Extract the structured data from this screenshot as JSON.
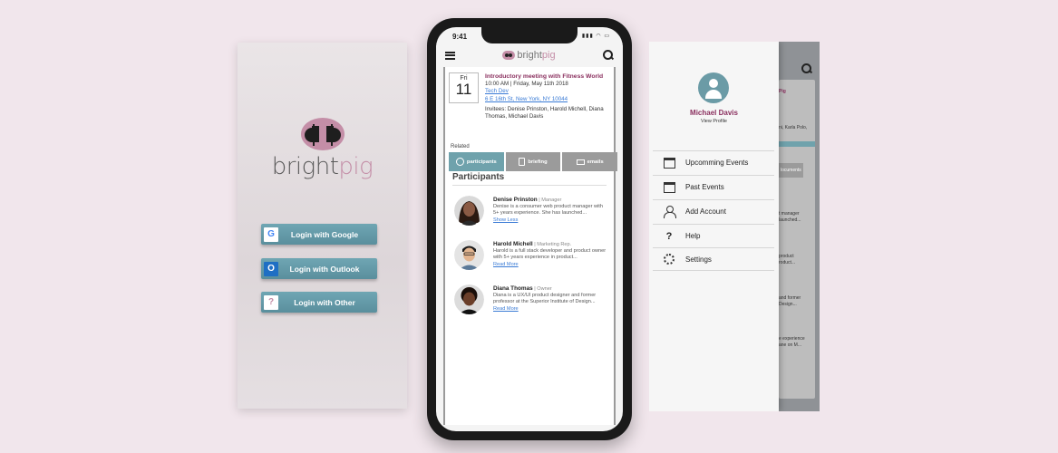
{
  "login": {
    "brand_prefix": "bright",
    "brand_suffix": "pig",
    "google_label": "Login with Google",
    "outlook_label": "Login with Outlook",
    "other_label": "Login with Other",
    "google_glyph": "G",
    "outlook_glyph": "O",
    "other_glyph": "?"
  },
  "phone": {
    "time": "9:41",
    "status_icons": "▮▮▮ ◠ ▭",
    "brand_prefix": "bright",
    "brand_suffix": "pig",
    "event": {
      "day_of_week": "Fri",
      "day_number": "11",
      "title": "Introductory meeting with Fitness World",
      "datetime": "10:00 AM | Friday, May 11th 2018",
      "location_name": "Tech Dev",
      "address": "6 E 16th St, New York, NY 10044",
      "invitees": "Invitees: Denise Prinston, Harold Michell, Diana Thomas, Michael Davis"
    },
    "related_label": "Related",
    "tabs": [
      "participants",
      "briefing",
      "emails"
    ],
    "participants_heading": "Participants",
    "participants": [
      {
        "name": "Denise Prinston",
        "role": "| Manager",
        "bio": "Denise is a consumer web product manager with 5+ years experience. She has launched...",
        "link": "Show Less",
        "skin": "#8a5a44",
        "hair": "#2b1a12"
      },
      {
        "name": "Harold Michell",
        "role": "| Marketing Rep.",
        "bio": "Harold is a full stack developer and product owner with 5+ years experience in product...",
        "link": "Read More",
        "skin": "#e2b48f",
        "hair": "#1b1b1b"
      },
      {
        "name": "Diana Thomas",
        "role": "| Owner",
        "bio": "Diana is a UX/UI product designer and former professor at the Superior Institute of Design...",
        "link": "Read More",
        "skin": "#6b3f2a",
        "hair": "#1a0f0a"
      }
    ]
  },
  "menu": {
    "profile_name": "Michael Davis",
    "view_profile": "View Profile",
    "items": [
      {
        "label": "Upcomming Events",
        "icon": "calendar-icon"
      },
      {
        "label": "Past Events",
        "icon": "calendar-check-icon"
      },
      {
        "label": "Add Account",
        "icon": "add-user-icon"
      },
      {
        "label": "Help",
        "icon": "help-icon",
        "glyph": "?"
      },
      {
        "label": "Settings",
        "icon": "gear-icon"
      }
    ],
    "bg_fragments": [
      "Pig",
      "ni, Karla Polo,",
      "locuments",
      "t manager",
      "launched...",
      "product",
      "roduct...",
      "and former",
      "Design...",
      "e experience",
      "ane on M..."
    ]
  },
  "colors": {
    "accent_teal": "#6fa2ac",
    "brand_pink": "#c48ea7",
    "title_plum": "#8a2f5e",
    "link_blue": "#3a7bd5"
  }
}
